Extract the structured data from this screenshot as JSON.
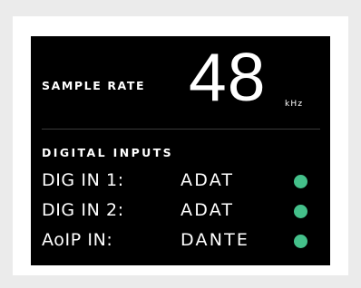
{
  "sample_rate": {
    "label": "SAMPLE RATE",
    "value": "48",
    "unit": "kHz"
  },
  "digital_inputs": {
    "heading": "DIGITAL INPUTS",
    "rows": [
      {
        "label": "DIG IN 1:",
        "value": "ADAT",
        "status_color": "#44c08a"
      },
      {
        "label": "DIG IN 2:",
        "value": "ADAT",
        "status_color": "#44c08a"
      },
      {
        "label": "AoIP IN:",
        "value": "DANTE",
        "status_color": "#44c08a"
      }
    ]
  }
}
